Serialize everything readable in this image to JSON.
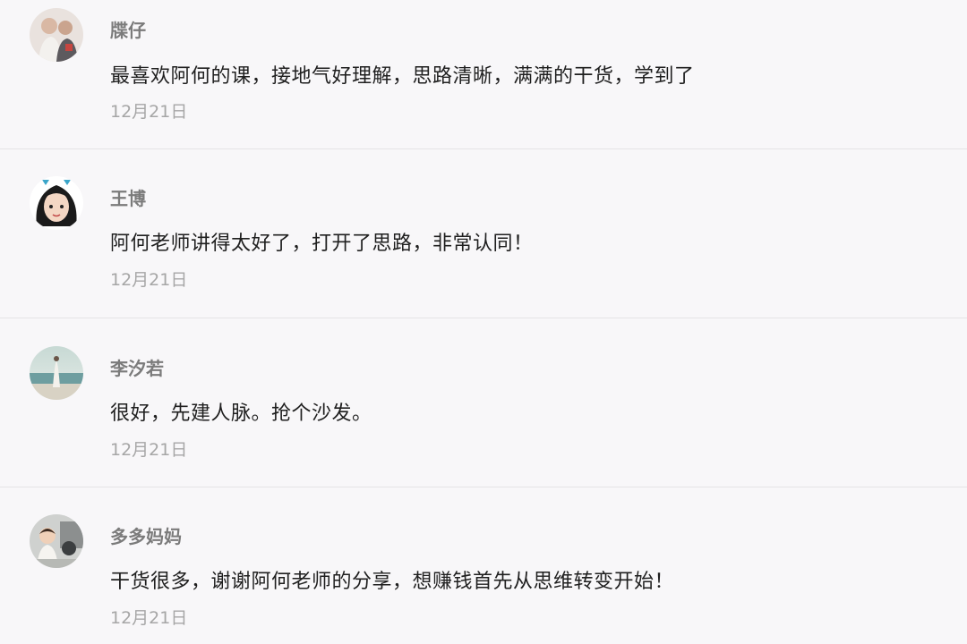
{
  "comments": [
    {
      "username": "牒仔",
      "avatar_icon": "user-photo-avatar-icon",
      "content": "最喜欢阿何的课，接地气好理解，思路清晰，满满的干货，学到了",
      "date": "12月21日"
    },
    {
      "username": "王博",
      "avatar_icon": "cartoon-girl-avatar-icon",
      "content": "阿何老师讲得太好了，打开了思路，非常认同！",
      "date": "12月21日"
    },
    {
      "username": "李汐若",
      "avatar_icon": "beach-photo-avatar-icon",
      "content": "很好，先建人脉。抢个沙发。",
      "date": "12月21日"
    },
    {
      "username": "多多妈妈",
      "avatar_icon": "child-photo-avatar-icon",
      "content": "干货很多，谢谢阿何老师的分享，想赚钱首先从思维转变开始！",
      "date": "12月21日"
    }
  ],
  "colors": {
    "background": "#f8f7f9",
    "username": "#7b7b7b",
    "content": "#1f1f1f",
    "date": "#a6a6a6",
    "divider": "#e4e3e6"
  }
}
